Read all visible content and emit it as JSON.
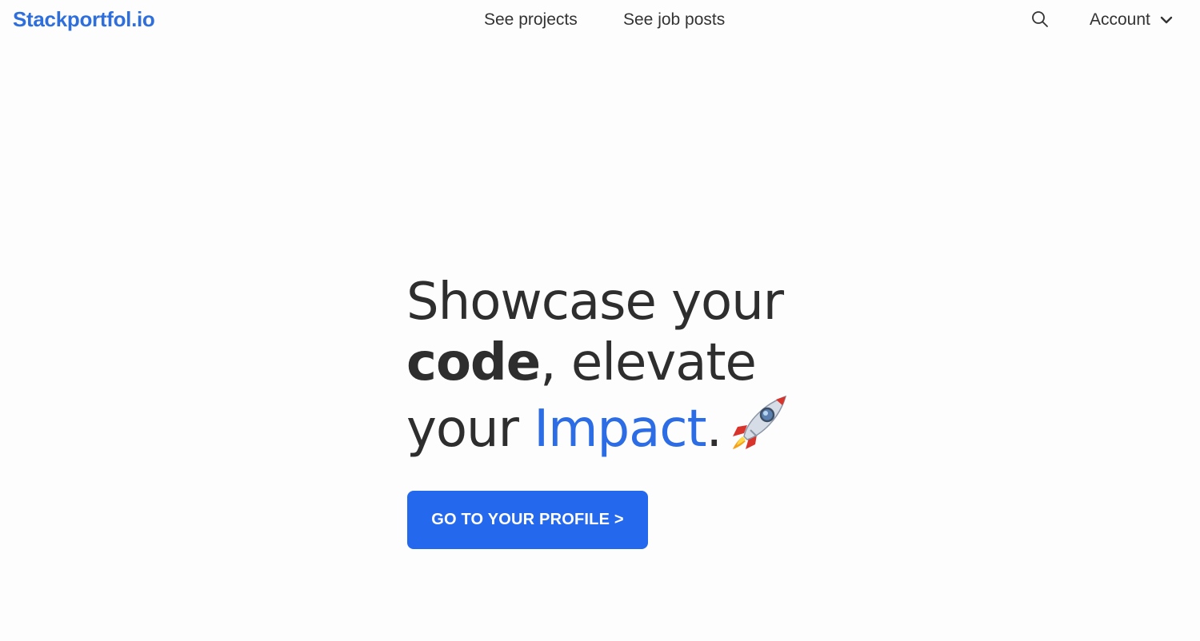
{
  "brand": {
    "name": "Stackportfol.io"
  },
  "nav": {
    "projects_label": "See projects",
    "jobs_label": "See job posts"
  },
  "header": {
    "search_icon": "search-icon",
    "account_label": "Account",
    "account_icon": "chevron-down-icon"
  },
  "hero": {
    "line1": "Showcase your",
    "line2_bold": "code",
    "line2_rest": ", elevate",
    "line3_start": "your ",
    "line3_accent": "Impact",
    "line3_end": ".",
    "emoji_icon": "rocket-icon",
    "cta_label": "GO TO YOUR PROFILE >"
  },
  "colors": {
    "brand": "#2f6fdc",
    "accent": "#2c6de6",
    "button": "#2468ee",
    "text": "#2e2e2e",
    "background": "#fdfdfd"
  }
}
